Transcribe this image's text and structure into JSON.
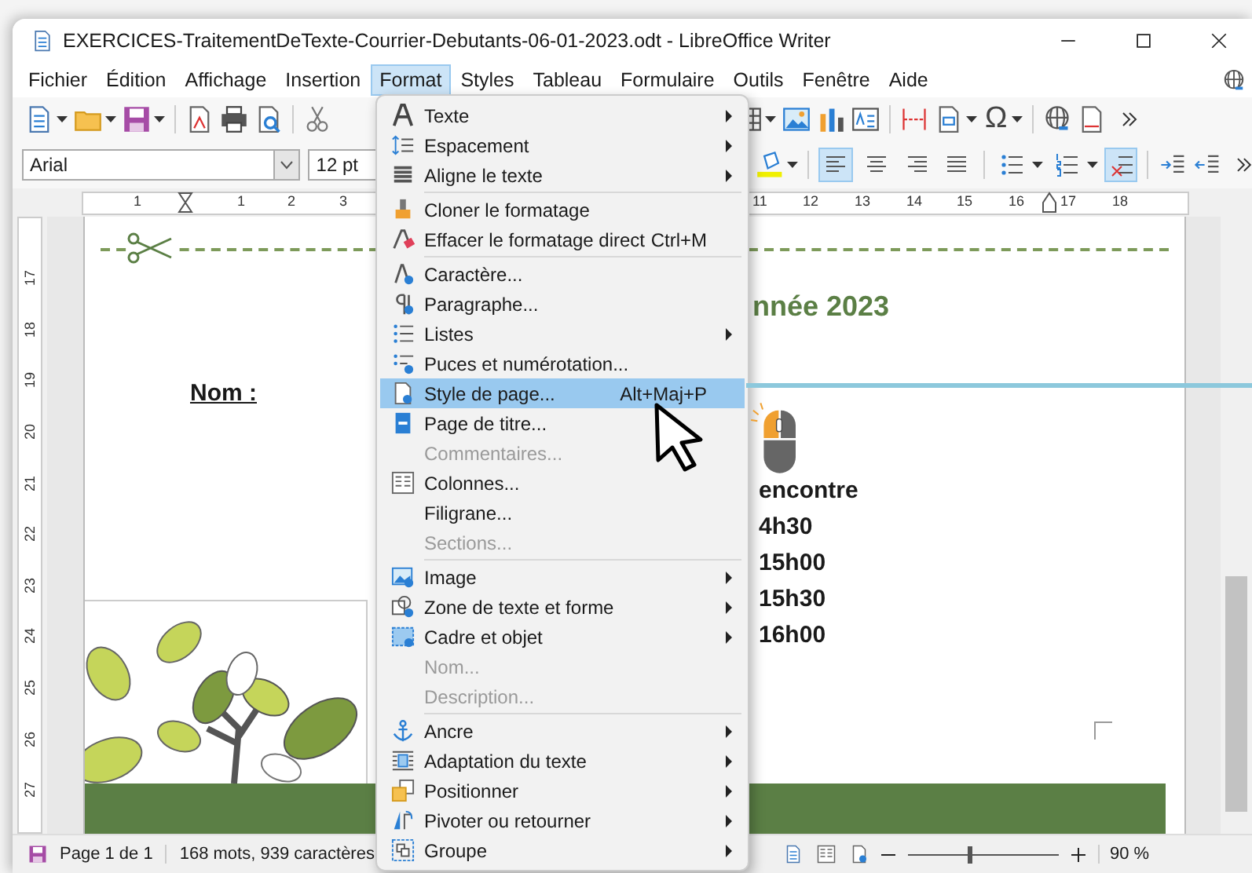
{
  "window": {
    "title": "EXERCICES-TraitementDeTexte-Courrier-Debutants-06-01-2023.odt - LibreOffice Writer"
  },
  "menubar": [
    {
      "label": "Fichier",
      "selected": false
    },
    {
      "label": "Édition",
      "selected": false
    },
    {
      "label": "Affichage",
      "selected": false
    },
    {
      "label": "Insertion",
      "selected": false
    },
    {
      "label": "Format",
      "selected": true
    },
    {
      "label": "Styles",
      "selected": false
    },
    {
      "label": "Tableau",
      "selected": false
    },
    {
      "label": "Formulaire",
      "selected": false
    },
    {
      "label": "Outils",
      "selected": false
    },
    {
      "label": "Fenêtre",
      "selected": false
    },
    {
      "label": "Aide",
      "selected": false
    }
  ],
  "toolbar": {
    "font_name": "Arial",
    "font_size": "12 pt",
    "special_character": "Ω"
  },
  "formatting": [
    {
      "kind": "align-left",
      "selected": true
    },
    {
      "kind": "align-center",
      "selected": false
    },
    {
      "kind": "align-right",
      "selected": false
    },
    {
      "kind": "justify",
      "selected": false
    }
  ],
  "lists": [
    {
      "kind": "bullets",
      "selected": false
    },
    {
      "kind": "numbering",
      "selected": false
    },
    {
      "kind": "no-list",
      "selected": true
    }
  ],
  "ruler": {
    "horizontal": [
      "1",
      "1",
      "2",
      "3",
      "11",
      "12",
      "13",
      "14",
      "15",
      "16",
      "17",
      "18"
    ],
    "vertical": [
      "17",
      "18",
      "19",
      "20",
      "21",
      "22",
      "23",
      "24",
      "25",
      "26",
      "27"
    ]
  },
  "document": {
    "heading": "nnée 2023",
    "name_label": "Nom :",
    "lines": [
      "encontre",
      "4h30",
      "15h00",
      "15h30",
      "16h00"
    ]
  },
  "format_menu": [
    {
      "kind": "item",
      "label": "Texte",
      "submenu": true,
      "disabled": false,
      "selected": false
    },
    {
      "kind": "item",
      "label": "Espacement",
      "submenu": true,
      "disabled": false,
      "selected": false
    },
    {
      "kind": "item",
      "label": "Aligne le texte",
      "submenu": true,
      "disabled": false,
      "selected": false
    },
    {
      "kind": "separator"
    },
    {
      "kind": "item",
      "label": "Cloner le formatage",
      "submenu": false,
      "disabled": false,
      "selected": false
    },
    {
      "kind": "item",
      "label": "Effacer le formatage direct",
      "shortcut": "Ctrl+M",
      "submenu": false,
      "disabled": false,
      "selected": false
    },
    {
      "kind": "separator"
    },
    {
      "kind": "item",
      "label": "Caractère...",
      "submenu": false,
      "disabled": false,
      "selected": false
    },
    {
      "kind": "item",
      "label": "Paragraphe...",
      "submenu": false,
      "disabled": false,
      "selected": false
    },
    {
      "kind": "item",
      "label": "Listes",
      "submenu": true,
      "disabled": false,
      "selected": false
    },
    {
      "kind": "item",
      "label": "Puces et numérotation...",
      "submenu": false,
      "disabled": false,
      "selected": false
    },
    {
      "kind": "item",
      "label": "Style de page...",
      "shortcut": "Alt+Maj+P",
      "submenu": false,
      "disabled": false,
      "selected": true
    },
    {
      "kind": "item",
      "label": "Page de titre...",
      "submenu": false,
      "disabled": false,
      "selected": false
    },
    {
      "kind": "item",
      "label": "Commentaires...",
      "submenu": false,
      "disabled": true,
      "selected": false
    },
    {
      "kind": "item",
      "label": "Colonnes...",
      "submenu": false,
      "disabled": false,
      "selected": false
    },
    {
      "kind": "item",
      "label": "Filigrane...",
      "submenu": false,
      "disabled": false,
      "selected": false
    },
    {
      "kind": "item",
      "label": "Sections...",
      "submenu": false,
      "disabled": true,
      "selected": false
    },
    {
      "kind": "separator"
    },
    {
      "kind": "item",
      "label": "Image",
      "submenu": true,
      "disabled": false,
      "selected": false
    },
    {
      "kind": "item",
      "label": "Zone de texte et forme",
      "submenu": true,
      "disabled": false,
      "selected": false
    },
    {
      "kind": "item",
      "label": "Cadre et objet",
      "submenu": true,
      "disabled": false,
      "selected": false
    },
    {
      "kind": "item",
      "label": "Nom...",
      "submenu": false,
      "disabled": true,
      "selected": false
    },
    {
      "kind": "item",
      "label": "Description...",
      "submenu": false,
      "disabled": true,
      "selected": false
    },
    {
      "kind": "separator"
    },
    {
      "kind": "item",
      "label": "Ancre",
      "submenu": true,
      "disabled": false,
      "selected": false
    },
    {
      "kind": "item",
      "label": "Adaptation du texte",
      "submenu": true,
      "disabled": false,
      "selected": false
    },
    {
      "kind": "item",
      "label": "Positionner",
      "submenu": true,
      "disabled": false,
      "selected": false
    },
    {
      "kind": "item",
      "label": "Pivoter ou retourner",
      "submenu": true,
      "disabled": false,
      "selected": false
    },
    {
      "kind": "item",
      "label": "Groupe",
      "submenu": true,
      "disabled": false,
      "selected": false
    }
  ],
  "status_bar": {
    "page": "Page 1 de 1",
    "words": "168 mots, 939 caractères",
    "zoom": "90 %",
    "zoom_slider": {
      "level": 0.4
    }
  }
}
